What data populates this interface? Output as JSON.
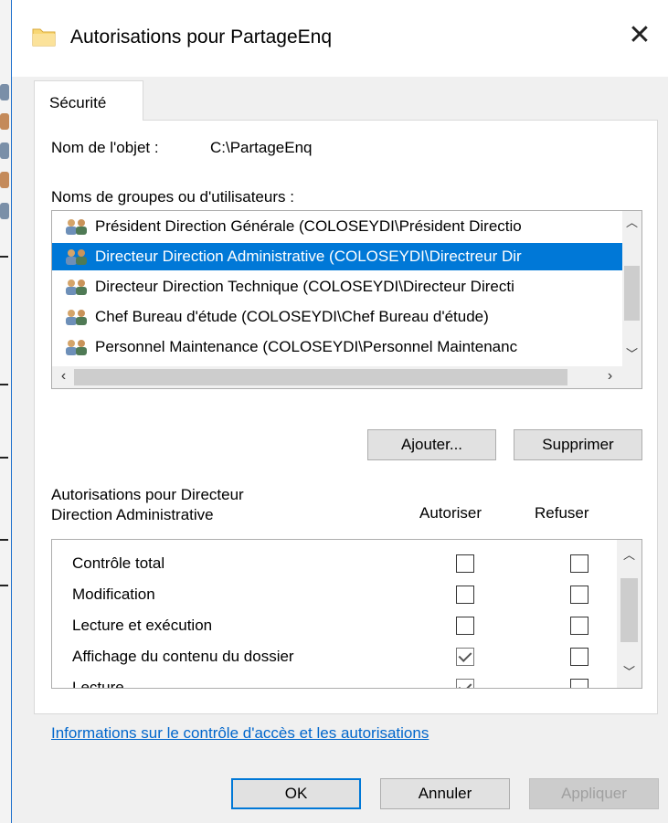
{
  "window": {
    "title": "Autorisations pour PartageEnq",
    "close_glyph": "✕"
  },
  "tab": {
    "label": "Sécurité"
  },
  "object": {
    "label": "Nom de l'objet :",
    "value": "C:\\PartageEnq"
  },
  "groups": {
    "label": "Noms de groupes ou d'utilisateurs :",
    "items": [
      {
        "text": "Président Direction Générale (COLOSEYDI\\Président Directio",
        "selected": false
      },
      {
        "text": "Directeur Direction Administrative (COLOSEYDI\\Directreur Dir",
        "selected": true
      },
      {
        "text": "Directeur Direction Technique (COLOSEYDI\\Directeur Directi",
        "selected": false
      },
      {
        "text": "Chef Bureau d'étude (COLOSEYDI\\Chef Bureau d'étude)",
        "selected": false
      },
      {
        "text": "Personnel Maintenance (COLOSEYDI\\Personnel Maintenanc",
        "selected": false
      }
    ]
  },
  "buttons": {
    "add": "Ajouter...",
    "remove": "Supprimer",
    "ok": "OK",
    "cancel": "Annuler",
    "apply": "Appliquer"
  },
  "permissions": {
    "title_line1": "Autorisations pour Directeur",
    "title_line2": "Direction Administrative",
    "allow_header": "Autoriser",
    "deny_header": "Refuser",
    "rows": [
      {
        "name": "Contrôle total",
        "allow": false,
        "deny": false
      },
      {
        "name": "Modification",
        "allow": false,
        "deny": false
      },
      {
        "name": "Lecture et exécution",
        "allow": false,
        "deny": false
      },
      {
        "name": "Affichage du contenu du dossier",
        "allow": true,
        "deny": false
      },
      {
        "name": "Lecture",
        "allow": true,
        "deny": false
      }
    ]
  },
  "link": {
    "text": "Informations sur le contrôle d'accès et les autorisations"
  },
  "colors": {
    "accent": "#0078d7",
    "link": "#0066cc",
    "folder": "#f8d775"
  }
}
